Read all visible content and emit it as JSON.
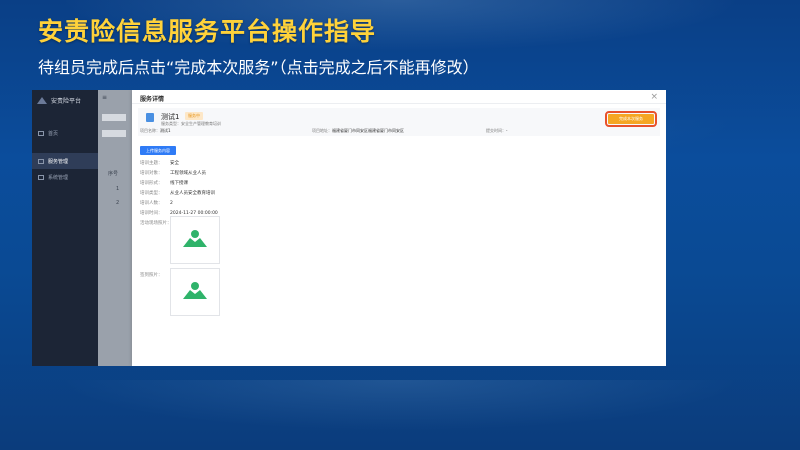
{
  "slide": {
    "title": "安责险信息服务平台操作指导",
    "subtitle": "待组员完成后点击“完成本次服务”（点击完成之后不能再修改）"
  },
  "app": {
    "name": "安责险平台",
    "sidebar_items": [
      "首页",
      "服务管理",
      "系统管理"
    ],
    "bg_rows": [
      "1",
      "2"
    ],
    "bg_header": "序号"
  },
  "modal": {
    "title": "服务详情",
    "close_glyph": "×",
    "service_name": "测试1",
    "status_badge": "服务中",
    "service_type": "服务类型：安全生产管理教育培训",
    "project_name_label": "项目名称：",
    "project_name_value": "测试1",
    "service_address_label": "项目地址：",
    "service_address_value": "福建省厦门市同安区福建省厦门市同安区",
    "finish_time_label": "提交时间：",
    "finish_time_value": "-",
    "complete_button": "完成本次服务",
    "upload_button": "上传服务内容",
    "fields": [
      {
        "label": "培训主题：",
        "value": "安全"
      },
      {
        "label": "培训对象：",
        "value": "工程领域从业人员"
      },
      {
        "label": "培训形式：",
        "value": "线下授课"
      },
      {
        "label": "培训类型：",
        "value": "从业人员安全教育培训"
      },
      {
        "label": "培训人数：",
        "value": "2"
      },
      {
        "label": "培训时间：",
        "value": "2024-11-27 00:00:00"
      }
    ],
    "photo1_label": "活动现场照片：",
    "photo2_label": "签到照片："
  }
}
